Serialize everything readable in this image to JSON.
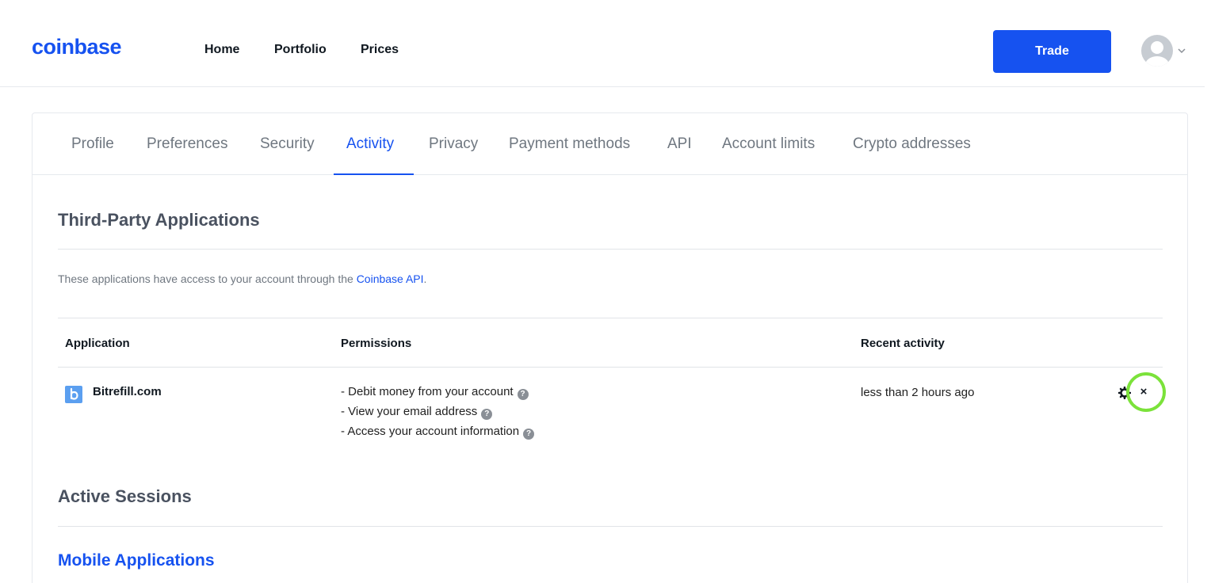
{
  "brand": {
    "name": "coinbase",
    "color": "#1652f0"
  },
  "nav": {
    "home": "Home",
    "portfolio": "Portfolio",
    "prices": "Prices",
    "trade_label": "Trade"
  },
  "tabs": [
    {
      "label": "Profile",
      "active": false
    },
    {
      "label": "Preferences",
      "active": false
    },
    {
      "label": "Security",
      "active": false
    },
    {
      "label": "Activity",
      "active": true
    },
    {
      "label": "Privacy",
      "active": false
    },
    {
      "label": "Payment methods",
      "active": false
    },
    {
      "label": "API",
      "active": false
    },
    {
      "label": "Account limits",
      "active": false
    },
    {
      "label": "Crypto addresses",
      "active": false
    }
  ],
  "third_party": {
    "title": "Third-Party Applications",
    "intro_text": "These applications have access to your account through the ",
    "intro_link": "Coinbase API",
    "intro_end": ".",
    "columns": {
      "application": "Application",
      "permissions": "Permissions",
      "recent_activity": "Recent activity"
    },
    "apps": [
      {
        "name": "Bitrefill.com",
        "logo_letter": "b",
        "permissions": [
          "- Debit money from your account",
          "- View your email address",
          "- Access your account information"
        ],
        "recent_activity": "less than 2 hours ago",
        "revoke_label": "×"
      }
    ]
  },
  "sessions": {
    "title": "Active Sessions",
    "mobile_title": "Mobile Applications"
  },
  "colors": {
    "accent": "#1652f0",
    "highlight_ring": "#7be23a",
    "muted_text": "#6f7780"
  }
}
